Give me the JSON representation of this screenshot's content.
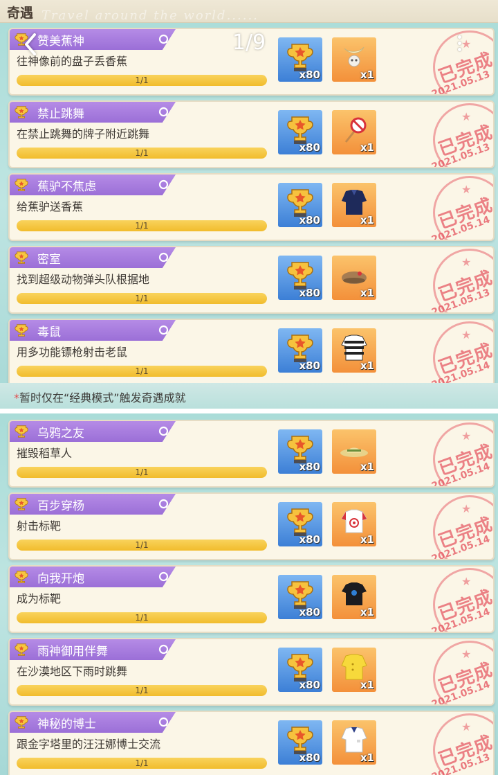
{
  "header": {
    "title": "奇遇",
    "watermark": "Travel around the world......"
  },
  "viewer": {
    "counter": "1/9"
  },
  "footnote": {
    "star": "*",
    "text": "暂时仅在“经典模式”触发奇遇成就"
  },
  "stamp_label": "已完成",
  "colors": {
    "tab_purple": "#a57ddf",
    "progress_yellow": "#f4c53a",
    "stamp_red": "#e65a64",
    "trophy_bg_blue": "#4f8fe0",
    "item_bg_orange": "#f5a04a"
  },
  "top_cards": [
    {
      "name": "赞美蕉神",
      "desc": "往神像前的盘子丢香蕉",
      "progress_text": "1/1",
      "progress": 1.0,
      "trophy_qty": "x80",
      "item_qty": "x1",
      "item_icon": "banana-skull-icon",
      "date": "2021.05.13"
    },
    {
      "name": "禁止跳舞",
      "desc": "在禁止跳舞的牌子附近跳舞",
      "progress_text": "1/1",
      "progress": 1.0,
      "trophy_qty": "x80",
      "item_qty": "x1",
      "item_icon": "no-dance-sign-icon",
      "date": "2021.05.13"
    },
    {
      "name": "蕉驴不焦虑",
      "desc": "给蕉驴送香蕉",
      "progress_text": "1/1",
      "progress": 1.0,
      "trophy_qty": "x80",
      "item_qty": "x1",
      "item_icon": "navy-jacket-icon",
      "date": "2021.05.14"
    },
    {
      "name": "密室",
      "desc": "找到超级动物弹头队根据地",
      "progress_text": "1/1",
      "progress": 1.0,
      "trophy_qty": "x80",
      "item_qty": "x1",
      "item_icon": "beret-icon",
      "date": "2021.05.13"
    },
    {
      "name": "毒鼠",
      "desc": "用多功能镖枪射击老鼠",
      "progress_text": "1/1",
      "progress": 1.0,
      "trophy_qty": "x80",
      "item_qty": "x1",
      "item_icon": "striped-prisoner-shirt-icon",
      "date": "2021.05.14"
    }
  ],
  "bottom_cards": [
    {
      "name": "乌鸦之友",
      "desc": "摧毁稻草人",
      "progress_text": "1/1",
      "progress": 1.0,
      "trophy_qty": "x80",
      "item_qty": "x1",
      "item_icon": "straw-hat-icon",
      "date": "2021.05.14"
    },
    {
      "name": "百步穿杨",
      "desc": "射击标靶",
      "progress_text": "1/1",
      "progress": 1.0,
      "trophy_qty": "x80",
      "item_qty": "x1",
      "item_icon": "target-shirt-icon",
      "date": "2021.05.14"
    },
    {
      "name": "向我开炮",
      "desc": "成为标靶",
      "progress_text": "1/1",
      "progress": 1.0,
      "trophy_qty": "x80",
      "item_qty": "x1",
      "item_icon": "black-tshirt-icon",
      "date": "2021.05.14"
    },
    {
      "name": "雨神御用伴舞",
      "desc": "在沙漠地区下雨时跳舞",
      "progress_text": "1/1",
      "progress": 1.0,
      "trophy_qty": "x80",
      "item_qty": "x1",
      "item_icon": "yellow-raincoat-icon",
      "date": "2021.05.14"
    },
    {
      "name": "神秘的博士",
      "desc": "跟金字塔里的汪汪娜博士交流",
      "progress_text": "1/1",
      "progress": 1.0,
      "trophy_qty": "x80",
      "item_qty": "x1",
      "item_icon": "lab-coat-icon",
      "date": "2021.05.13"
    }
  ]
}
